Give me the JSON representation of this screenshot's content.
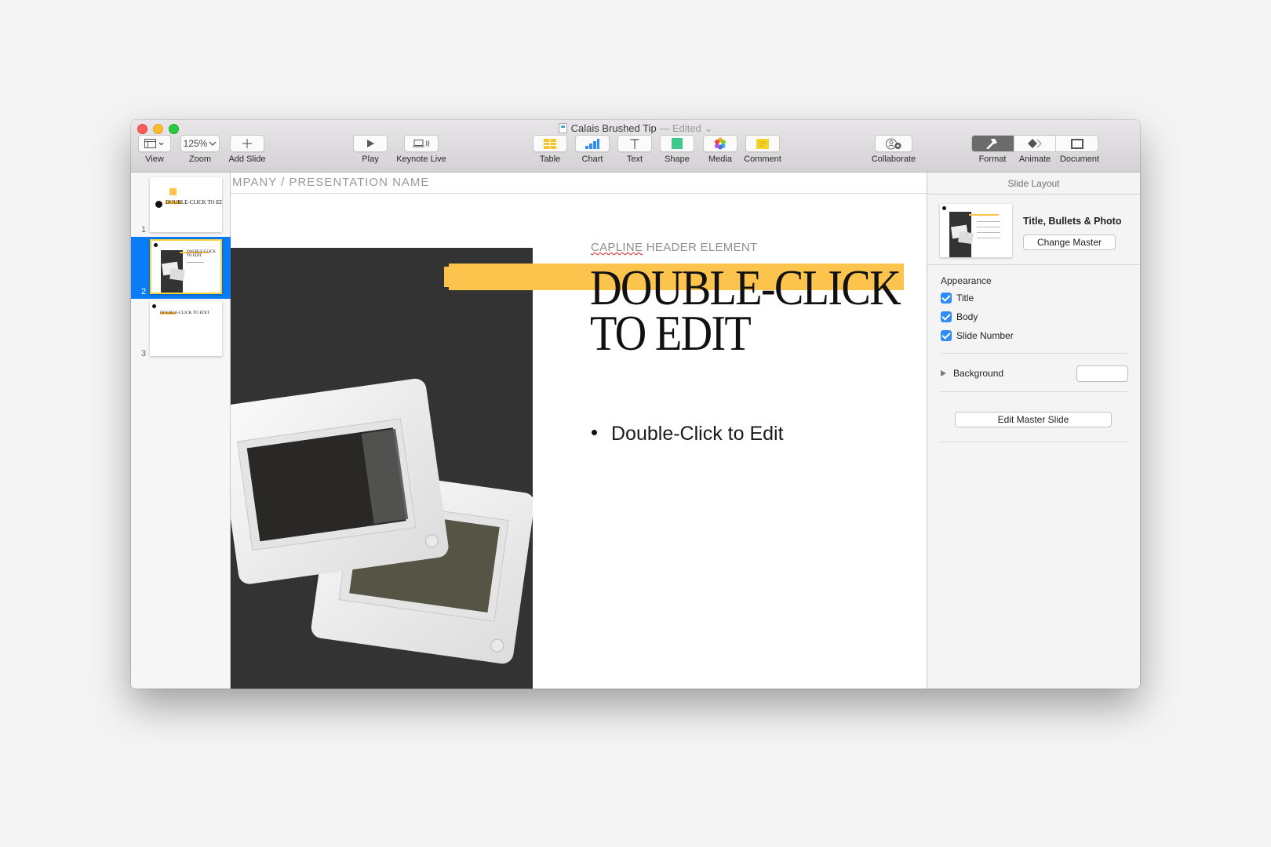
{
  "window": {
    "doc_title": "Calais Brushed Tip",
    "doc_status": "— Edited"
  },
  "toolbar": {
    "view": {
      "label": "View",
      "icon": "sidebar-layout-icon"
    },
    "zoom": {
      "label": "Zoom",
      "value": "125%"
    },
    "add_slide": {
      "label": "Add Slide",
      "icon": "plus-icon"
    },
    "play": {
      "label": "Play",
      "icon": "play-icon"
    },
    "keynote_live": {
      "label": "Keynote Live",
      "icon": "broadcast-icon"
    },
    "table": {
      "label": "Table",
      "icon": "table-icon",
      "color": "#f7c52b"
    },
    "chart": {
      "label": "Chart",
      "icon": "chart-icon",
      "color": "#2f8df3"
    },
    "text": {
      "label": "Text",
      "icon": "text-icon"
    },
    "shape": {
      "label": "Shape",
      "icon": "shape-icon",
      "color": "#3fc98d"
    },
    "media": {
      "label": "Media",
      "icon": "photos-icon"
    },
    "comment": {
      "label": "Comment",
      "icon": "comment-icon",
      "color": "#f7d32b"
    },
    "collaborate": {
      "label": "Collaborate",
      "icon": "collaborate-icon"
    },
    "format": {
      "label": "Format",
      "icon": "paintbrush-icon",
      "active": true
    },
    "animate": {
      "label": "Animate",
      "icon": "animate-icon"
    },
    "document": {
      "label": "Document",
      "icon": "document-icon"
    }
  },
  "navigator": {
    "slides": [
      {
        "number": "1",
        "title": "DOUBLE-CLICK TO EDIT"
      },
      {
        "number": "2",
        "title": "DOUBLE-CLICK TO EDIT",
        "selected": true
      },
      {
        "number": "3",
        "title": "DOUBLE-CLICK TO EDIT"
      }
    ]
  },
  "slide": {
    "header": "COMPANY / PRESENTATION NAME",
    "header_visible": "MPANY / PRESENTATION NAME",
    "caption_misspelled": "CAPLINE",
    "caption_rest": " HEADER ELEMENT",
    "title_line1": "DOUBLE-CLICK",
    "title_line2": "TO EDIT",
    "bullet": "Double-Click to Edit",
    "accent_color": "#fcc44c"
  },
  "inspector": {
    "tab": "Slide Layout",
    "layout_name": "Title, Bullets & Photo",
    "change_master": "Change Master",
    "appearance_label": "Appearance",
    "appearance": [
      {
        "label": "Title",
        "checked": true
      },
      {
        "label": "Body",
        "checked": true
      },
      {
        "label": "Slide Number",
        "checked": true
      }
    ],
    "background_label": "Background",
    "edit_master": "Edit Master Slide"
  }
}
